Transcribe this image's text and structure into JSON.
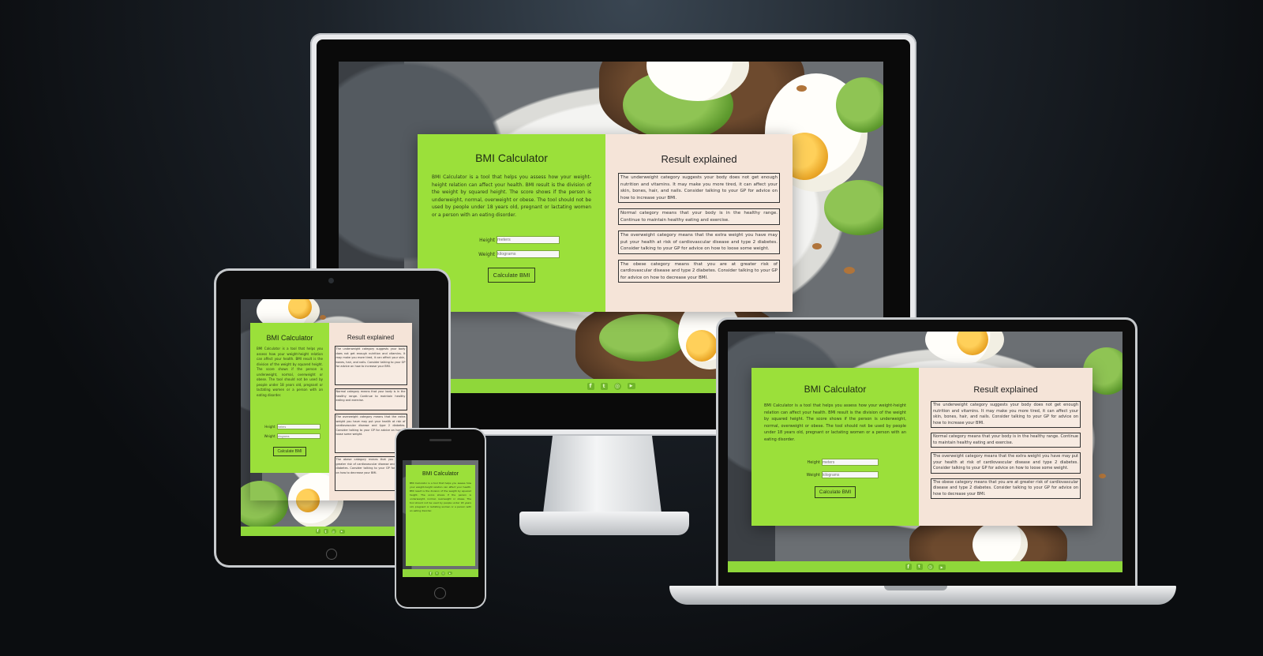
{
  "app": {
    "title": "BMI Calculator",
    "description": "BMI Calculator is a tool that helps you assess how your weight-height relation can affect your health. BMI result is the division of the weight by squared height. The score shows if the person is underweight, normal, overweight or obese. The tool should not be used by people under 18 years old, pregnant or lactating women or a person with an eating disorder.",
    "form": {
      "height_label": "Height",
      "height_placeholder": "meters",
      "weight_label": "Weight",
      "weight_placeholder": "kilograms",
      "button": "Calculate BMI"
    },
    "results": {
      "title": "Result explained",
      "items": [
        "The underweight category suggests your body does not get enough nutrition and vitamins. It may make you more tired, it can affect your skin, bones, hair, and nails. Consider talking to your GP for advice on how to increase your BMI.",
        "Normal category means that your body is in the healthy range. Continue to maintain healthy eating and exercise.",
        "The overweight category means that the extra weight you have may put your health at risk of cardiovascular disease and type 2 diabetes. Consider talking to your GP for advice on how to loose some weight.",
        "The obese category means that you are at greater risk of cardiovascular disease and type 2 diabetes. Consider talking to your GP for advice on how to decrease your BMI."
      ]
    },
    "footer_icons": [
      "facebook-icon",
      "twitter-icon",
      "instagram-icon",
      "youtube-icon"
    ],
    "colors": {
      "accent_green": "#9be03a",
      "result_panel": "#f5e4d8",
      "footer_green": "#8fd73a"
    }
  }
}
